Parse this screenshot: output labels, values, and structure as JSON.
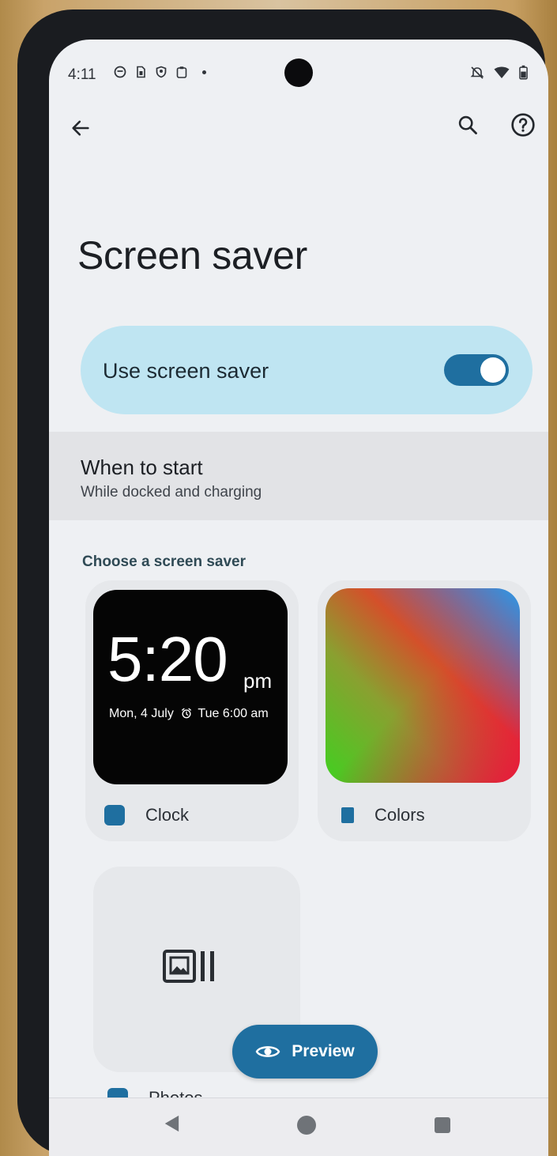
{
  "status_bar": {
    "time": "4:11",
    "left_icons": [
      "notification-icon",
      "sim-icon",
      "shield-icon",
      "clipboard-icon"
    ],
    "right_icons": [
      "mute-icon",
      "wifi-icon",
      "battery-icon"
    ]
  },
  "app_bar": {
    "back_icon": "arrow-left-icon",
    "search_icon": "search-icon",
    "help_icon": "help-circle-icon"
  },
  "page": {
    "title": "Screen saver"
  },
  "main_toggle": {
    "label": "Use screen saver",
    "state": "on"
  },
  "when_to_start": {
    "title": "When to start",
    "subtitle": "While docked and charging"
  },
  "choose": {
    "heading": "Choose a screen saver",
    "options": [
      {
        "label": "Clock",
        "selected": true,
        "preview": {
          "time": "5:20",
          "ampm": "pm",
          "date": "Mon, 4 July",
          "alarm": "Tue 6:00 am"
        }
      },
      {
        "label": "Colors",
        "selected": false
      },
      {
        "label": "Photos",
        "selected": false
      }
    ]
  },
  "fab": {
    "label": "Preview",
    "icon": "eye-icon"
  },
  "nav_bar": {
    "icons": [
      "nav-back-icon",
      "nav-home-icon",
      "nav-recents-icon"
    ]
  },
  "colors": {
    "accent": "#1f6fa0",
    "toggle_card_bg": "#bfe5f2",
    "screen_bg": "#eef0f3"
  }
}
